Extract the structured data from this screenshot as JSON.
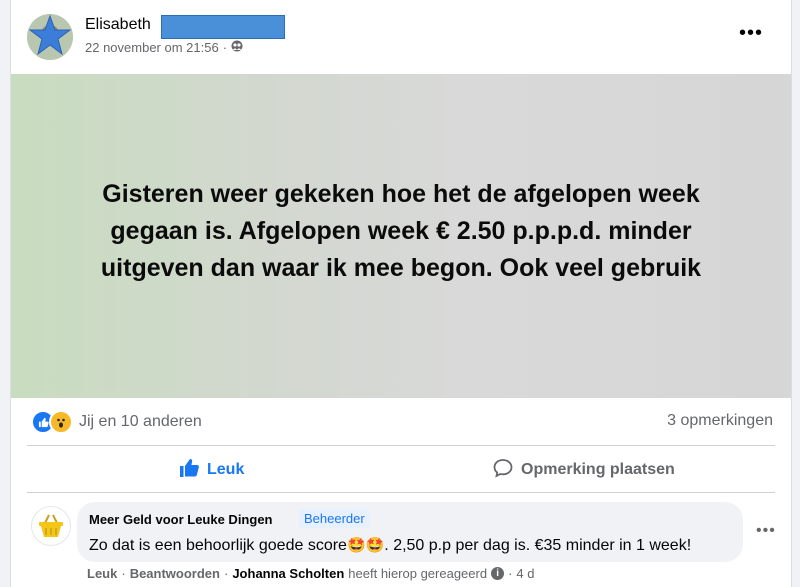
{
  "post": {
    "author": "Elisabeth",
    "timestamp": "22 november om 21:56",
    "separator": "·",
    "privacy_icon": "group-members-icon",
    "more_icon": "more-options-icon",
    "body": "Gisteren weer gekeken hoe het de afgelopen week gegaan is. Afgelopen week € 2.50 p.p.p.d. minder uitgeven dan waar ik mee begon. Ook veel gebruik",
    "reaction_summary": "Jij en 10 anderen",
    "reaction_icons": [
      "like-reaction-icon",
      "wow-reaction-icon"
    ],
    "comment_count": "3 opmerkingen",
    "actions": {
      "like": "Leuk",
      "comment": "Opmerking plaatsen"
    }
  },
  "comment": {
    "author": "Meer Geld voor Leuke Dingen",
    "badge": "Beheerder",
    "text_before": "Zo dat is een behoorlijk goede score",
    "emoji": "🤩🤩",
    "text_after": ". 2,50 p.p per dag is. €35 minder in 1 week!",
    "actions": {
      "like": "Leuk",
      "reply": "Beantwoorden",
      "separator": "·",
      "reply_author": "Johanna Scholten",
      "reply_text": "heeft hierop gereageerd",
      "age": "4 d"
    }
  },
  "colors": {
    "accent": "#1877f2",
    "redaction": "#4a90d9",
    "muted": "#65676b"
  }
}
